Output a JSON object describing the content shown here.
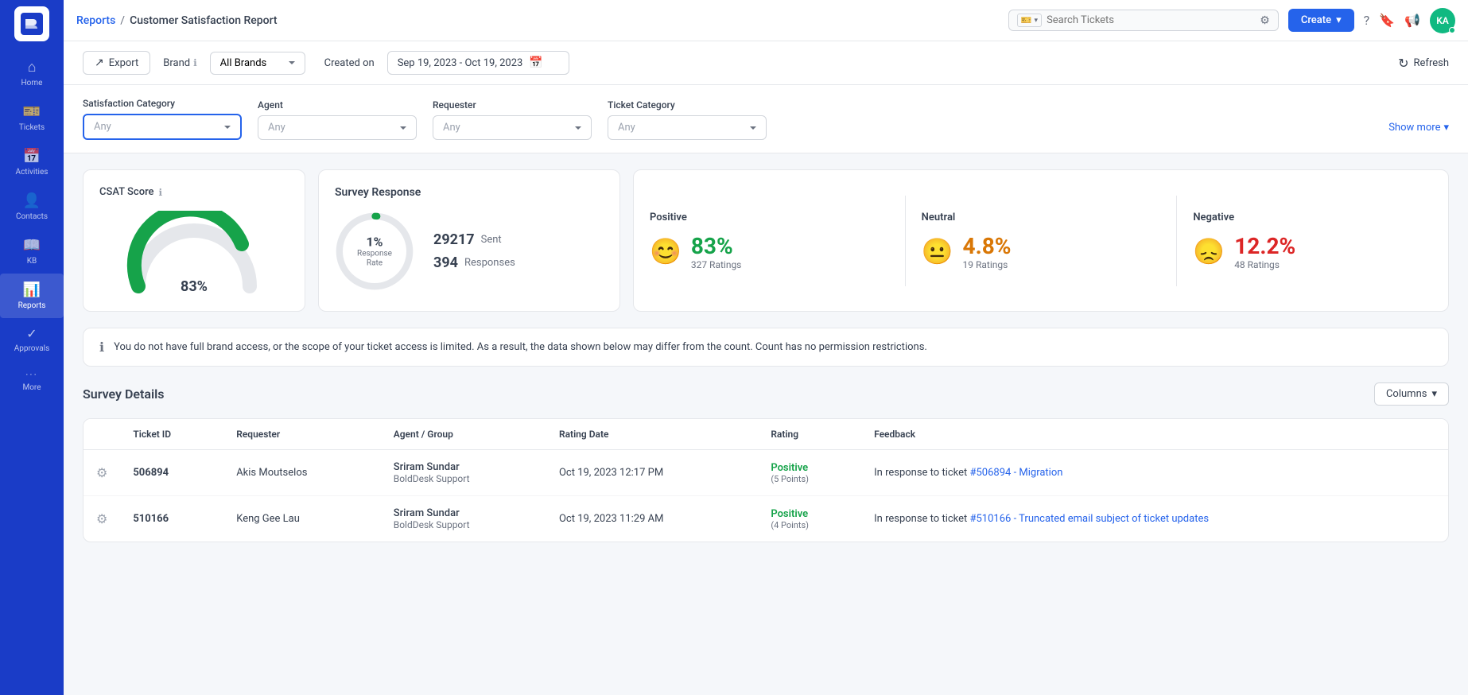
{
  "app": {
    "logo_initials": "B"
  },
  "sidebar": {
    "items": [
      {
        "id": "home",
        "label": "Home",
        "icon": "⌂",
        "active": false
      },
      {
        "id": "tickets",
        "label": "Tickets",
        "icon": "🎫",
        "active": false
      },
      {
        "id": "activities",
        "label": "Activities",
        "icon": "📅",
        "active": false
      },
      {
        "id": "contacts",
        "label": "Contacts",
        "icon": "👤",
        "active": false
      },
      {
        "id": "kb",
        "label": "KB",
        "icon": "📖",
        "active": false
      },
      {
        "id": "reports",
        "label": "Reports",
        "icon": "📊",
        "active": true
      },
      {
        "id": "approvals",
        "label": "Approvals",
        "icon": "✓",
        "active": false
      },
      {
        "id": "more",
        "label": "More",
        "icon": "···",
        "active": false
      }
    ]
  },
  "topbar": {
    "breadcrumb_link": "Reports",
    "breadcrumb_sep": "/",
    "breadcrumb_current": "Customer Satisfaction Report",
    "search_placeholder": "Search Tickets",
    "create_label": "Create",
    "avatar_initials": "KA"
  },
  "action_bar": {
    "export_label": "Export",
    "brand_label": "Brand",
    "brand_default": "All Brands",
    "created_label": "Created on",
    "date_range": "Sep 19, 2023 - Oct 19, 2023",
    "refresh_label": "Refresh"
  },
  "filters": {
    "satisfaction_category_label": "Satisfaction Category",
    "satisfaction_category_placeholder": "Any",
    "agent_label": "Agent",
    "agent_placeholder": "Any",
    "requester_label": "Requester",
    "requester_placeholder": "Any",
    "ticket_category_label": "Ticket Category",
    "ticket_category_placeholder": "Any",
    "show_more_label": "Show more"
  },
  "csat": {
    "title": "CSAT Score",
    "value": "83%"
  },
  "survey_response": {
    "title": "Survey Response",
    "response_rate_pct": "1%",
    "response_rate_label": "Response Rate",
    "sent_count": "29217",
    "sent_label": "Sent",
    "responses_count": "394",
    "responses_label": "Responses"
  },
  "sentiment": {
    "positive": {
      "label": "Positive",
      "pct": "83%",
      "ratings": "327 Ratings"
    },
    "neutral": {
      "label": "Neutral",
      "pct": "4.8%",
      "ratings": "19 Ratings"
    },
    "negative": {
      "label": "Negative",
      "pct": "12.2%",
      "ratings": "48 Ratings"
    }
  },
  "warning": {
    "message": "You do not have full brand access, or the scope of your ticket access is limited. As a result, the data shown below may differ from the count. Count has no permission restrictions."
  },
  "survey_details": {
    "title": "Survey Details",
    "columns_label": "Columns",
    "columns": [
      {
        "key": "ticket_id",
        "label": "Ticket ID"
      },
      {
        "key": "requester",
        "label": "Requester"
      },
      {
        "key": "agent_group",
        "label": "Agent / Group"
      },
      {
        "key": "rating_date",
        "label": "Rating Date"
      },
      {
        "key": "rating",
        "label": "Rating"
      },
      {
        "key": "feedback",
        "label": "Feedback"
      }
    ],
    "rows": [
      {
        "ticket_id": "506894",
        "requester": "Akis Moutselos",
        "agent": "Sriram Sundar",
        "group": "BoldDesk Support",
        "rating_date": "Oct 19, 2023 12:17 PM",
        "rating": "Positive",
        "rating_points": "(5 Points)",
        "feedback_text": "In response to ticket ",
        "feedback_link_text": "#506894 - Migration",
        "feedback_link": "#506894"
      },
      {
        "ticket_id": "510166",
        "requester": "Keng Gee Lau",
        "agent": "Sriram Sundar",
        "group": "BoldDesk Support",
        "rating_date": "Oct 19, 2023 11:29 AM",
        "rating": "Positive",
        "rating_points": "(4 Points)",
        "feedback_text": "In response to ticket ",
        "feedback_link_text": "#510166 - Truncated email subject of ticket updates",
        "feedback_link": "#510166"
      }
    ]
  }
}
